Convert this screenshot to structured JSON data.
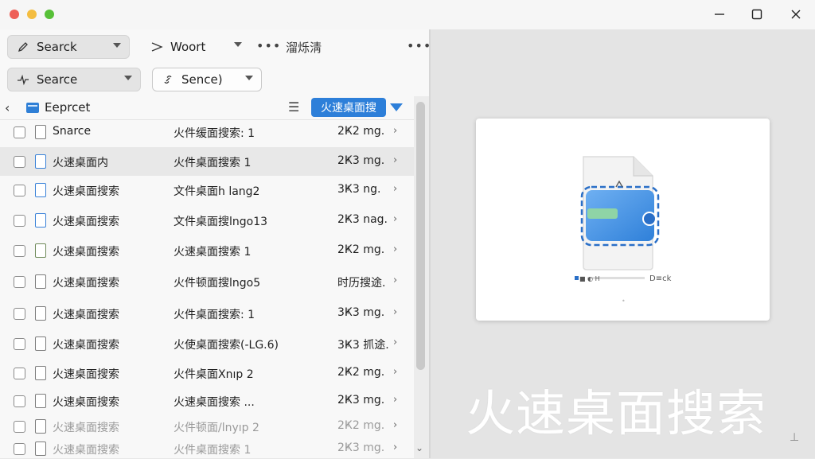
{
  "window_controls": {
    "minimize": "—",
    "maximize": "☐",
    "close": "✕"
  },
  "toolbar": {
    "row1": {
      "dropdown1": "Searck",
      "dropdown2": "Woort",
      "more": "•••",
      "label": "溜烁淸",
      "more2": "•••"
    },
    "row2": {
      "dropdown1": "Searce",
      "dropdown2": "Sence)"
    }
  },
  "path": {
    "back": "‹",
    "folder": "Eeprcet",
    "list_icon": "☰",
    "chip": "火速桌面搜"
  },
  "files": [
    {
      "name": "Snarce",
      "desc": "火件缓面搜索: 1",
      "size": "2Ҝ2 mg.",
      "icon": "gray",
      "selected": false
    },
    {
      "name": "火速桌面内",
      "desc": "火件桌面搜索 1",
      "size": "2Ҝ3 mg.",
      "icon": "blue",
      "selected": true
    },
    {
      "name": "火速桌面搜索",
      "desc": "文件桌面h lang2",
      "size": "3Ҝ3 ng.",
      "icon": "blue",
      "selected": false
    },
    {
      "name": "火速桌面搜索",
      "desc": "文件桌面搜lngo13",
      "size": "2Ҝ3 nag.",
      "icon": "blue",
      "selected": false
    },
    {
      "name": "火速桌面搜索",
      "desc": "火速桌面搜索 1",
      "size": "2Ҝ2 mg.",
      "icon": "green",
      "selected": false
    },
    {
      "name": "火速桌面搜索",
      "desc": "火件顿面搜lngo5",
      "size": "时历搜途.",
      "icon": "gray",
      "selected": false
    },
    {
      "name": "火速桌面搜索",
      "desc": "火件桌面搜索: 1",
      "size": "3Ҝ3 mg.",
      "icon": "gray",
      "selected": false
    },
    {
      "name": "火速桌面搜索",
      "desc": "火使桌面搜索(-LG.6)",
      "size": "3Ҝ3 抓途.",
      "icon": "gray",
      "selected": false
    },
    {
      "name": "火速桌面搜索",
      "desc": "火件桌面Xnıp 2",
      "size": "2Ҝ2 mg.",
      "icon": "gray",
      "selected": false
    },
    {
      "name": "火速桌面搜索",
      "desc": "火速桌面搜索 ...",
      "size": "2Ҝ3 mg.",
      "icon": "gray",
      "selected": false
    },
    {
      "name": "火速桌面搜索",
      "desc": "火件顿面/lnyıp 2",
      "size": "2Ҝ2 mg.",
      "icon": "gray",
      "selected": false
    },
    {
      "name": "火速桌面搜索",
      "desc": "火件桌面搜索 1",
      "size": "2Ҝ3 mg.",
      "icon": "gray",
      "selected": false
    }
  ],
  "preview": {
    "caption_line": "■ ◐ H",
    "caption_right": "D≡ck",
    "dot": "•",
    "big_caption": "火速桌面搜索",
    "corner_icon": "⊥"
  },
  "colors": {
    "accent": "#2d7fd9",
    "traffic_red": "#ee5f57",
    "traffic_yellow": "#f4bd40",
    "traffic_green": "#57c038"
  }
}
